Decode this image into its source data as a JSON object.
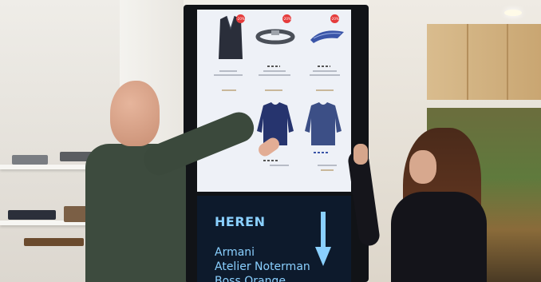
{
  "kiosk": {
    "badges": [
      "-20%",
      "-20%",
      "-20%"
    ],
    "heading": "HEREN",
    "brands": [
      "Armani",
      "Atelier Noterman",
      "Boss Orange"
    ],
    "accent_color": "#8ad0ff",
    "badge_color": "#e53b3b"
  }
}
